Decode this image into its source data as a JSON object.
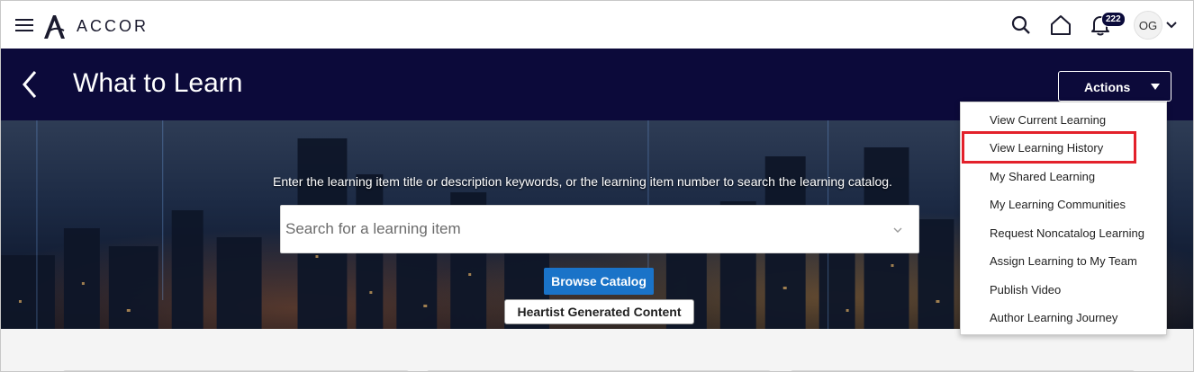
{
  "brand": {
    "name": "ACCOR"
  },
  "topbar": {
    "notification_count": "222",
    "avatar_initials": "OG"
  },
  "header": {
    "title": "What to Learn",
    "actions_label": "Actions"
  },
  "hero": {
    "instruction": "Enter the learning item title or description keywords, or the learning item number to search the learning catalog.",
    "search_placeholder": "Search for a learning item",
    "browse_label": "Browse Catalog",
    "heartist_label": "Heartist Generated Content"
  },
  "actions_menu": {
    "items": [
      {
        "label": "View Current Learning"
      },
      {
        "label": "View Learning History",
        "highlighted": true
      },
      {
        "label": "My Shared Learning"
      },
      {
        "label": "My Learning Communities"
      },
      {
        "label": "Request Noncatalog Learning"
      },
      {
        "label": "Assign Learning to My Team"
      },
      {
        "label": "Publish Video"
      },
      {
        "label": "Author Learning Journey"
      }
    ]
  },
  "colors": {
    "header_bg": "#0c0a3a",
    "browse_button": "#1a73c8",
    "highlight_box": "#e3212b"
  }
}
